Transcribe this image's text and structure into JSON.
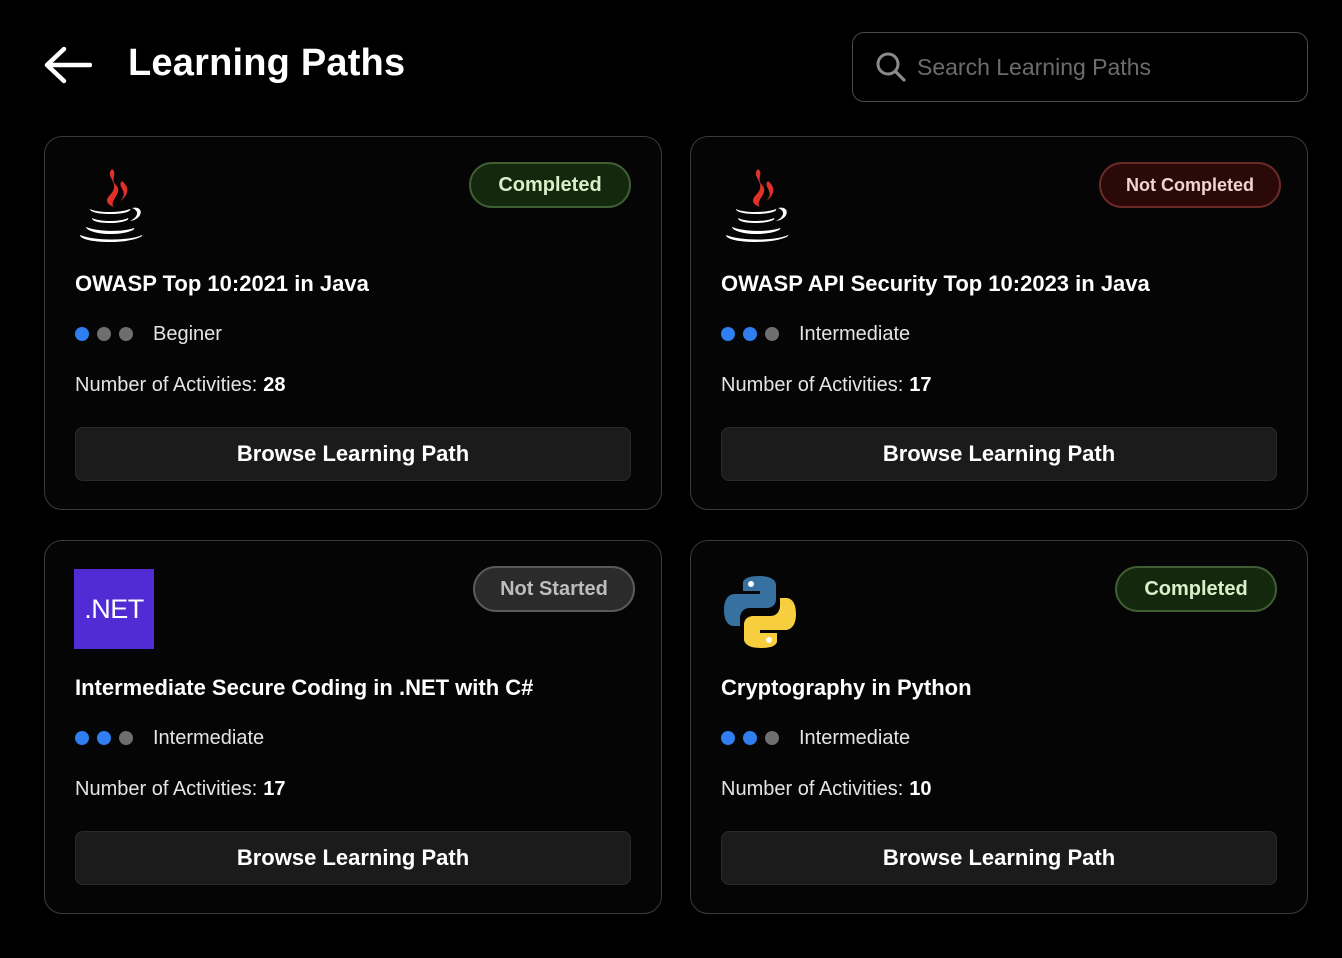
{
  "header": {
    "title": "Learning Paths",
    "search_placeholder": "Search Learning Paths"
  },
  "colors": {
    "background": "#000000",
    "level_dot_active": "#2f7ff0",
    "level_dot_inactive": "#6e6e6e",
    "net_brand": "#512bd4"
  },
  "cards": [
    {
      "title": "OWASP Top 10:2021 in Java",
      "logo_icon": "java-icon",
      "status": "Completed",
      "level_label": "Beginer",
      "level": 1,
      "level_max": 3,
      "activities_label": "Number of Activities:",
      "activities_count": "28",
      "button_label": "Browse Learning Path"
    },
    {
      "title": "OWASP API Security Top 10:2023 in Java",
      "logo_icon": "java-icon",
      "status": "Not Completed",
      "level_label": "Intermediate",
      "level": 2,
      "level_max": 3,
      "activities_label": "Number of Activities:",
      "activities_count": "17",
      "button_label": "Browse Learning Path"
    },
    {
      "title": "Intermediate Secure Coding in .NET with C#",
      "logo_icon": "dotnet-icon",
      "logo_text": ".NET",
      "status": "Not Started",
      "level_label": "Intermediate",
      "level": 2,
      "level_max": 3,
      "activities_label": "Number of Activities:",
      "activities_count": "17",
      "button_label": "Browse Learning Path"
    },
    {
      "title": "Cryptography in Python",
      "logo_icon": "python-icon",
      "status": "Completed",
      "level_label": "Intermediate",
      "level": 2,
      "level_max": 3,
      "activities_label": "Number of Activities:",
      "activities_count": "10",
      "button_label": "Browse Learning Path"
    }
  ]
}
